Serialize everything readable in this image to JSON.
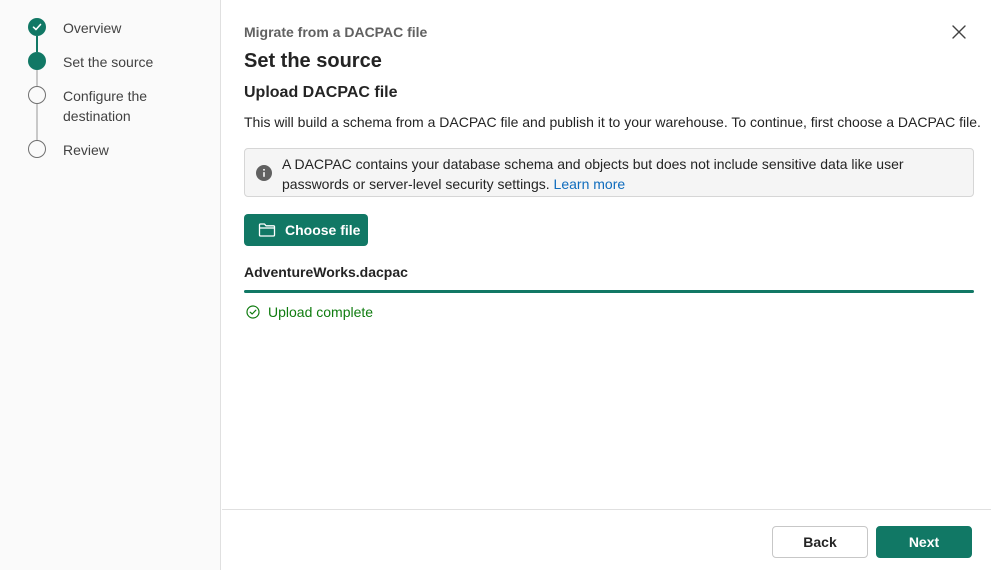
{
  "steps": [
    {
      "label": "Overview",
      "state": "done"
    },
    {
      "label": "Set the source",
      "state": "current"
    },
    {
      "label": "Configure the destination",
      "state": "todo"
    },
    {
      "label": "Review",
      "state": "todo"
    }
  ],
  "wizard": {
    "title": "Migrate from a DACPAC file",
    "page_title": "Set the source",
    "section_title": "Upload DACPAC file",
    "description": "This will build a schema from a DACPAC file and publish it to your warehouse. To continue, first choose a DACPAC file."
  },
  "info": {
    "text": "A DACPAC contains your database schema and objects but does not include sensitive data like user passwords or server-level security settings.",
    "link": "Learn more"
  },
  "upload": {
    "button_label": "Choose file",
    "file_name": "AdventureWorks.dacpac",
    "progress_percent": 100,
    "status": "Upload complete"
  },
  "footer": {
    "back_label": "Back",
    "next_label": "Next"
  },
  "colors": {
    "accent": "#117865",
    "success": "#107c10",
    "link": "#0f6cbd"
  },
  "icons": {
    "close": "close-icon",
    "info": "info-icon",
    "folder": "folder-icon",
    "success": "check-circle-icon",
    "step_done": "checkmark-icon"
  }
}
